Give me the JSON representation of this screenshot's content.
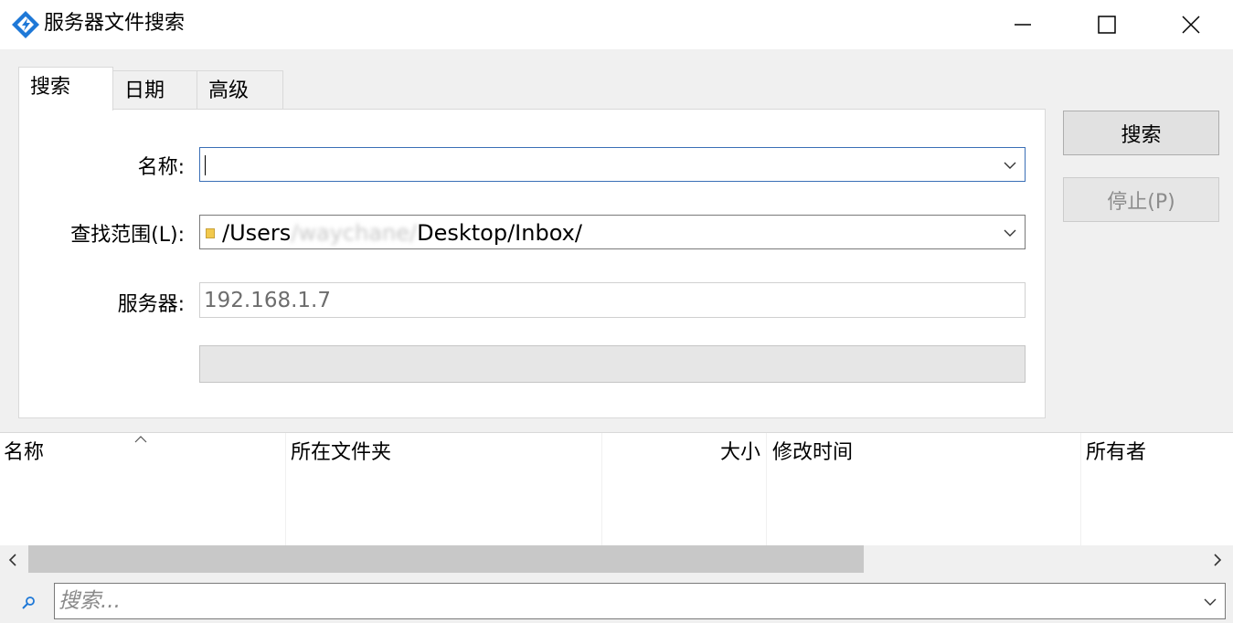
{
  "window": {
    "title": "服务器文件搜索"
  },
  "tabs": [
    {
      "label": "搜索",
      "active": true
    },
    {
      "label": "日期",
      "active": false
    },
    {
      "label": "高级",
      "active": false
    }
  ],
  "form": {
    "name_label": "名称:",
    "name_value": "",
    "scope_label": "查找范围(L):",
    "scope_prefix": "/Users",
    "scope_blurred": "/waychane/",
    "scope_suffix": "Desktop/Inbox/",
    "server_label": "服务器:",
    "server_value": "192.168.1.7"
  },
  "buttons": {
    "search": "搜索",
    "stop": "停止(P)"
  },
  "table": {
    "columns": [
      "名称",
      "所在文件夹",
      "大小",
      "修改时间",
      "所有者"
    ]
  },
  "filter": {
    "placeholder": "搜索..."
  },
  "colors": {
    "accent": "#3a6fb6",
    "icon_blue": "#1e78d7"
  }
}
